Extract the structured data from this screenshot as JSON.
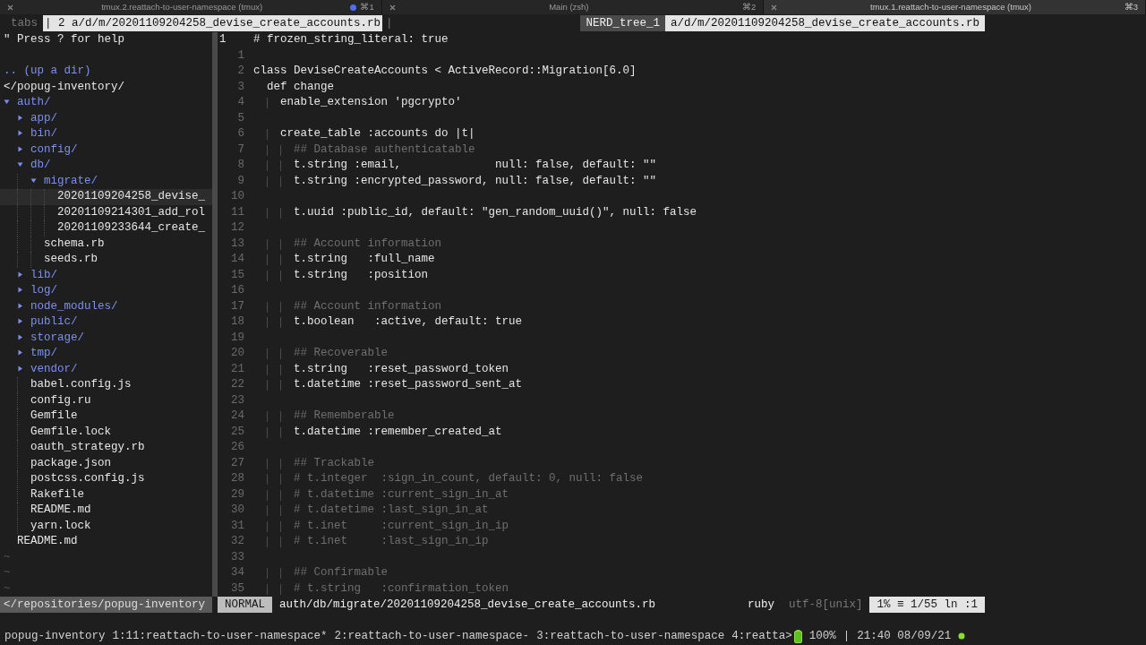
{
  "terminal_tabs": [
    {
      "title": "tmux.2.reattach-to-user-namespace (tmux)",
      "shortcut": "⌘1",
      "selected": false,
      "activity": true
    },
    {
      "title": "Main (zsh)",
      "shortcut": "⌘2",
      "selected": false,
      "activity": false
    },
    {
      "title": "tmux.1.reattach-to-user-namespace (tmux)",
      "shortcut": "⌘3",
      "selected": true,
      "activity": false
    }
  ],
  "tabline": {
    "label": "tabs",
    "tabs": [
      {
        "text": "| 2 a/d/m/20201109204258_devise_create_accounts.rb",
        "selected": true
      }
    ],
    "trailing": "|",
    "right": [
      {
        "text": "NERD_tree_1",
        "kind": "name"
      },
      {
        "text": "a/d/m/20201109204258_devise_create_accounts.rb",
        "kind": "file"
      }
    ]
  },
  "nerdtree": {
    "help": "\" Press ? for help",
    "up": ".. (up a dir)",
    "root": "</popug-inventory/",
    "items": [
      {
        "name": "auth/",
        "kind": "dir",
        "expanded": true,
        "selected": false,
        "children": [
          {
            "name": "app/",
            "kind": "dir",
            "expanded": false,
            "selected": false
          },
          {
            "name": "bin/",
            "kind": "dir",
            "expanded": false,
            "selected": false
          },
          {
            "name": "config/",
            "kind": "dir",
            "expanded": false,
            "selected": false
          },
          {
            "name": "db/",
            "kind": "dir",
            "expanded": true,
            "selected": false,
            "children": [
              {
                "name": "migrate/",
                "kind": "dir",
                "expanded": true,
                "selected": false,
                "children": [
                  {
                    "name": "20201109204258_devise_",
                    "kind": "file",
                    "selected": true
                  },
                  {
                    "name": "20201109214301_add_rol",
                    "kind": "file",
                    "selected": false
                  },
                  {
                    "name": "20201109233644_create_",
                    "kind": "file",
                    "selected": false
                  }
                ]
              },
              {
                "name": "schema.rb",
                "kind": "file",
                "selected": false
              },
              {
                "name": "seeds.rb",
                "kind": "file",
                "selected": false
              }
            ]
          },
          {
            "name": "lib/",
            "kind": "dir",
            "expanded": false,
            "selected": false
          },
          {
            "name": "log/",
            "kind": "dir",
            "expanded": false,
            "selected": false
          },
          {
            "name": "node_modules/",
            "kind": "dir",
            "expanded": false,
            "selected": false
          },
          {
            "name": "public/",
            "kind": "dir",
            "expanded": false,
            "selected": false
          },
          {
            "name": "storage/",
            "kind": "dir",
            "expanded": false,
            "selected": false
          },
          {
            "name": "tmp/",
            "kind": "dir",
            "expanded": false,
            "selected": false
          },
          {
            "name": "vendor/",
            "kind": "dir",
            "expanded": false,
            "selected": false
          },
          {
            "name": "babel.config.js",
            "kind": "file",
            "selected": false
          },
          {
            "name": "config.ru",
            "kind": "file",
            "selected": false
          },
          {
            "name": "Gemfile",
            "kind": "file",
            "selected": false
          },
          {
            "name": "Gemfile.lock",
            "kind": "file",
            "selected": false
          },
          {
            "name": "oauth_strategy.rb",
            "kind": "file",
            "selected": false
          },
          {
            "name": "package.json",
            "kind": "file",
            "selected": false
          },
          {
            "name": "postcss.config.js",
            "kind": "file",
            "selected": false
          },
          {
            "name": "Rakefile",
            "kind": "file",
            "selected": false
          },
          {
            "name": "README.md",
            "kind": "file",
            "selected": false
          },
          {
            "name": "yarn.lock",
            "kind": "file",
            "selected": false
          }
        ]
      },
      {
        "name": "README.md",
        "kind": "file",
        "selected": false
      }
    ],
    "fillers": [
      "~",
      "~",
      "~"
    ],
    "status": "</repositories/popug-inventory"
  },
  "editor": {
    "lines": [
      {
        "number": "1",
        "text": "# frozen_string_literal: true",
        "kind": "code",
        "selected": true
      },
      {
        "number": "1",
        "selected": false
      },
      {
        "number": "2",
        "text": "class DeviseCreateAccounts < ActiveRecord::Migration[6.0]",
        "kind": "code",
        "selected": false
      },
      {
        "number": "3",
        "text": "  def change",
        "kind": "code",
        "selected": false
      },
      {
        "number": "4",
        "text": "    enable_extension 'pgcrypto'",
        "kind": "code",
        "selected": false
      },
      {
        "number": "5",
        "selected": false
      },
      {
        "number": "6",
        "text": "    create_table :accounts do |t|",
        "kind": "code",
        "selected": false
      },
      {
        "number": "7",
        "text": "      ## Database authenticatable",
        "kind": "comment",
        "selected": false
      },
      {
        "number": "8",
        "text": "      t.string :email,              null: false, default: \"\"",
        "kind": "code",
        "selected": false
      },
      {
        "number": "9",
        "text": "      t.string :encrypted_password, null: false, default: \"\"",
        "kind": "code",
        "selected": false
      },
      {
        "number": "10",
        "selected": false
      },
      {
        "number": "11",
        "text": "      t.uuid :public_id, default: \"gen_random_uuid()\", null: false",
        "kind": "code",
        "selected": false
      },
      {
        "number": "12",
        "selected": false
      },
      {
        "number": "13",
        "text": "      ## Account information",
        "kind": "comment",
        "selected": false
      },
      {
        "number": "14",
        "text": "      t.string   :full_name",
        "kind": "code",
        "selected": false
      },
      {
        "number": "15",
        "text": "      t.string   :position",
        "kind": "code",
        "selected": false
      },
      {
        "number": "16",
        "selected": false
      },
      {
        "number": "17",
        "text": "      ## Account information",
        "kind": "comment",
        "selected": false
      },
      {
        "number": "18",
        "text": "      t.boolean   :active, default: true",
        "kind": "code",
        "selected": false
      },
      {
        "number": "19",
        "selected": false
      },
      {
        "number": "20",
        "text": "      ## Recoverable",
        "kind": "comment",
        "selected": false
      },
      {
        "number": "21",
        "text": "      t.string   :reset_password_token",
        "kind": "code",
        "selected": false
      },
      {
        "number": "22",
        "text": "      t.datetime :reset_password_sent_at",
        "kind": "code",
        "selected": false
      },
      {
        "number": "23",
        "selected": false
      },
      {
        "number": "24",
        "text": "      ## Rememberable",
        "kind": "comment",
        "selected": false
      },
      {
        "number": "25",
        "text": "      t.datetime :remember_created_at",
        "kind": "code",
        "selected": false
      },
      {
        "number": "26",
        "selected": false
      },
      {
        "number": "27",
        "text": "      ## Trackable",
        "kind": "comment",
        "selected": false
      },
      {
        "number": "28",
        "text": "      # t.integer  :sign_in_count, default: 0, null: false",
        "kind": "comment",
        "selected": false
      },
      {
        "number": "29",
        "text": "      # t.datetime :current_sign_in_at",
        "kind": "comment",
        "selected": false
      },
      {
        "number": "30",
        "text": "      # t.datetime :last_sign_in_at",
        "kind": "comment",
        "selected": false
      },
      {
        "number": "31",
        "text": "      # t.inet     :current_sign_in_ip",
        "kind": "comment",
        "selected": false
      },
      {
        "number": "32",
        "text": "      # t.inet     :last_sign_in_ip",
        "kind": "comment",
        "selected": false
      },
      {
        "number": "33",
        "selected": false
      },
      {
        "number": "34",
        "text": "      ## Confirmable",
        "kind": "comment",
        "selected": false
      },
      {
        "number": "35",
        "text": "      # t.string   :confirmation_token",
        "kind": "comment",
        "selected": false
      }
    ]
  },
  "statusline": {
    "mode": "NORMAL",
    "file": "auth/db/migrate/20201109204258_devise_create_accounts.rb",
    "filetype": "ruby",
    "encoding": "utf-8[unix]",
    "position": "1% ≡ 1/55 ln :1"
  },
  "tmux": {
    "session": "popug-inventory",
    "windows": [
      "1:11:reattach-to-user-namespace*",
      "2:reattach-to-user-namespace-",
      "3:reattach-to-user-namespace",
      "4:reatta>"
    ],
    "battery": "100%",
    "separator": "|",
    "clock": "21:40 08/09/21"
  }
}
